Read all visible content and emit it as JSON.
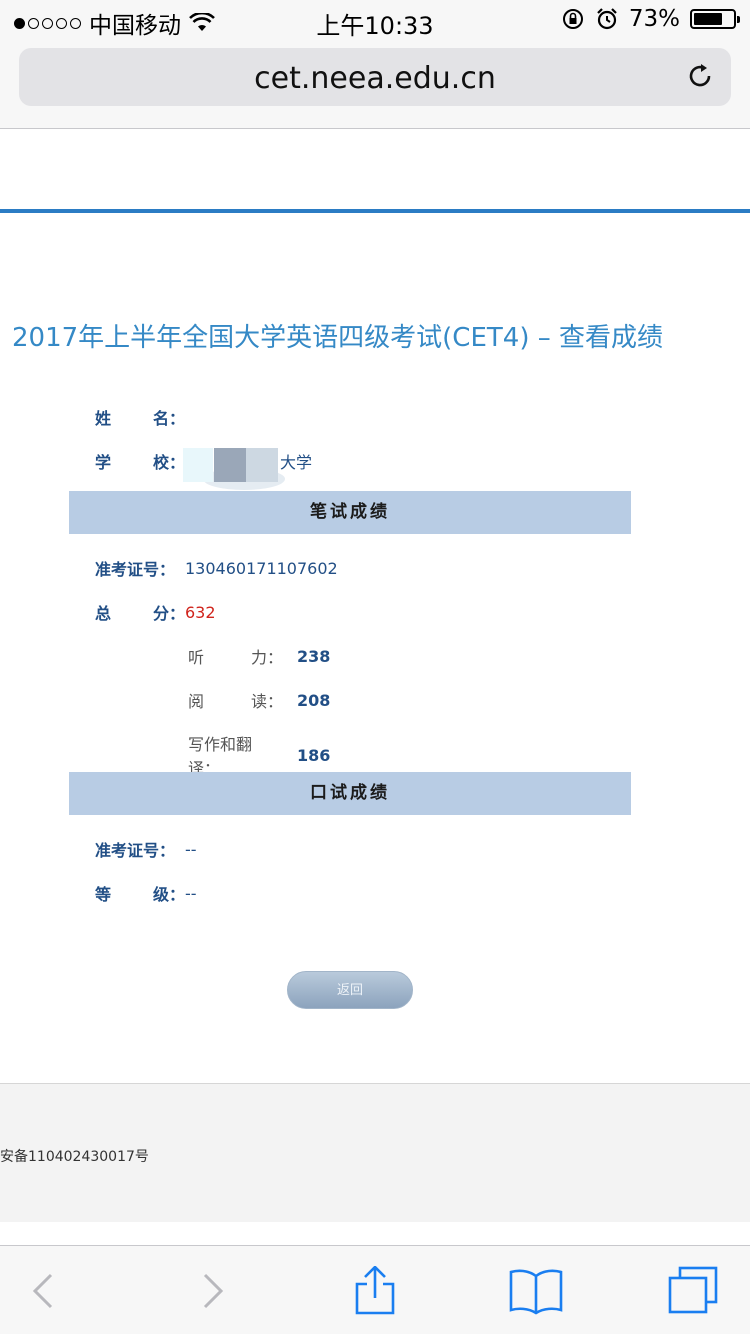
{
  "status_bar": {
    "carrier": "中国移动",
    "time": "上午10:33",
    "battery_percent_text": "73%",
    "battery_level": 0.73
  },
  "browser": {
    "url": "cet.neea.edu.cn"
  },
  "page": {
    "title": "2017年上半年全国大学英语四级考试(CET4) – 查看成绩",
    "name_label": [
      "姓",
      "名："
    ],
    "school_label": [
      "学",
      "校："
    ],
    "school_visible_tail": "大学",
    "written_section": "笔试成绩",
    "written": {
      "exam_id_label": "准考证号：",
      "exam_id": "130460171107602",
      "total_label": [
        "总",
        "分："
      ],
      "total": "632",
      "listening_label": [
        "听",
        "力："
      ],
      "listening": "238",
      "reading_label": [
        "阅",
        "读："
      ],
      "reading": "208",
      "writing_label": "写作和翻译：",
      "writing": "186"
    },
    "oral_section": "口试成绩",
    "oral": {
      "exam_id_label": "准考证号：",
      "exam_id": "--",
      "grade_label": [
        "等",
        "级："
      ],
      "grade": "--"
    },
    "back_button": "返回",
    "footer_text": "安备110402430017号"
  },
  "colors": {
    "accent_blue": "#2b7cc4",
    "label_blue": "#224f86",
    "score_red": "#d0241c",
    "section_bar": "#b8cce4"
  }
}
